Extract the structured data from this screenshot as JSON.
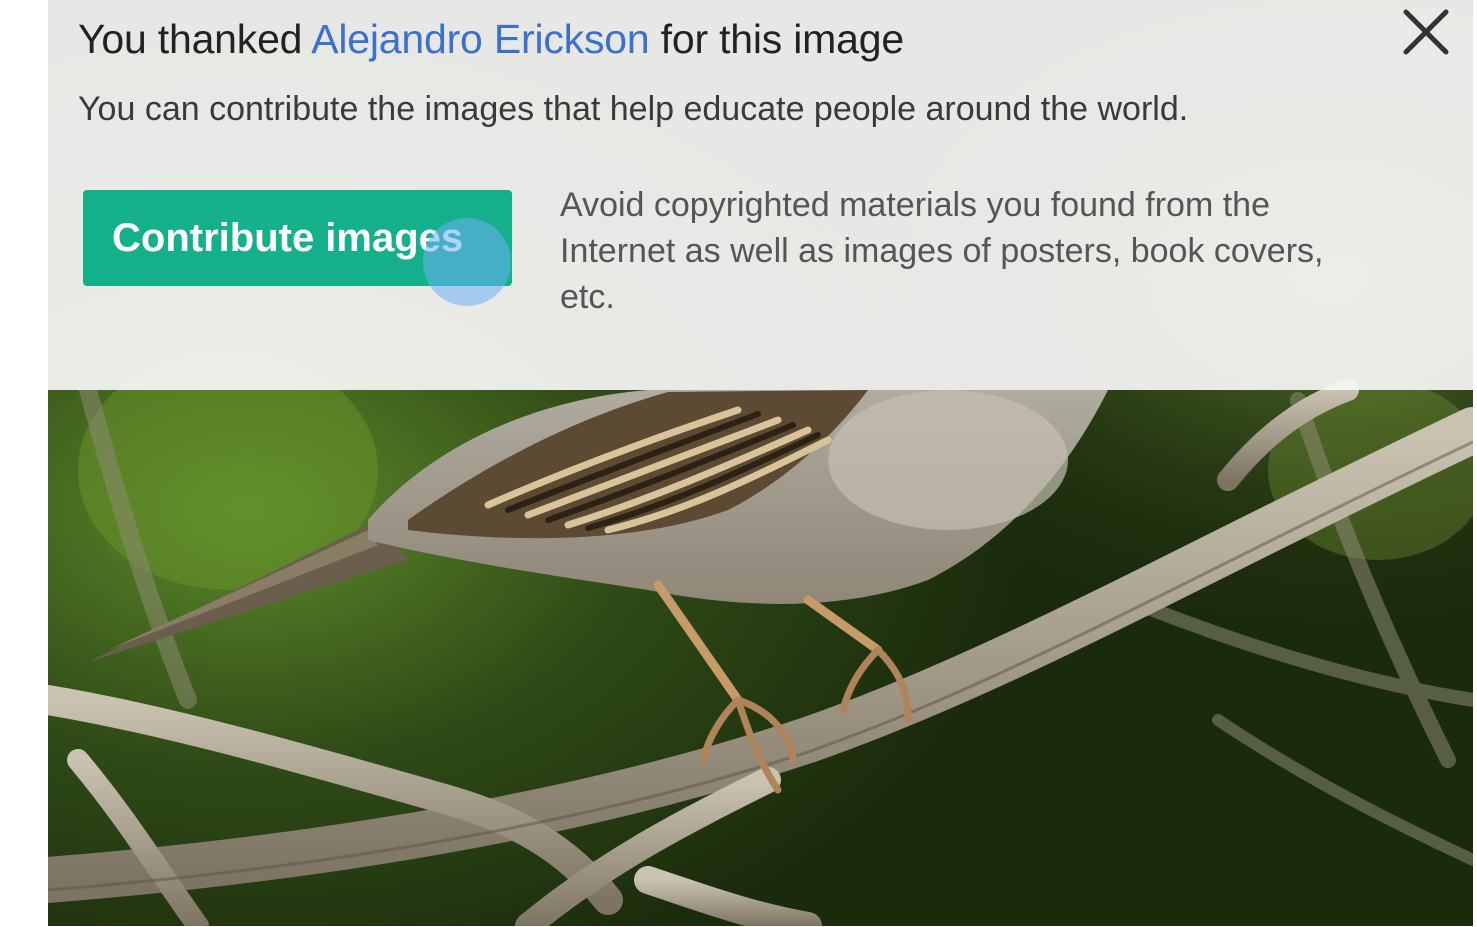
{
  "dialog": {
    "headline_prefix": "You thanked ",
    "author_link": "Alejandro Erickson",
    "headline_suffix": " for this image",
    "subline": "You can contribute the images that help educate people around the world.",
    "close_icon": "close-icon",
    "close_glyph": "✕"
  },
  "actions": {
    "contribute_label": "Contribute images",
    "contribute_color": "#14b08c"
  },
  "notice": {
    "text": "Avoid copyrighted materials you found from the Internet as well as images of posters, book covers, etc."
  },
  "colors": {
    "link": "#3b6fd0",
    "panel_overlay": "#f4f4f3"
  }
}
